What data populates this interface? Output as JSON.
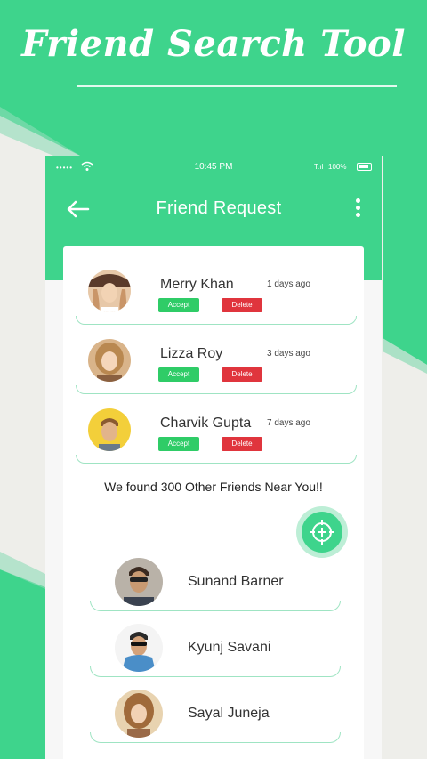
{
  "banner": {
    "title": "Friend Search Tool"
  },
  "colors": {
    "accent": "#3ed48c",
    "accept": "#2fcc67",
    "delete": "#e0353d",
    "background": "#eeeeea"
  },
  "status_bar": {
    "time": "10:45 PM",
    "battery_label": "100%",
    "signal_label": "T.ıl"
  },
  "header": {
    "title": "Friend Request",
    "back_icon": "arrow-left-icon",
    "menu_icon": "more-vertical-icon"
  },
  "requests": [
    {
      "name": "Merry Khan",
      "time": "1 days ago",
      "accept_label": "Accept",
      "delete_label": "Delete"
    },
    {
      "name": "Lizza Roy",
      "time": "3 days ago",
      "accept_label": "Accept",
      "delete_label": "Delete"
    },
    {
      "name": "Charvik Gupta",
      "time": "7 days ago",
      "accept_label": "Accept",
      "delete_label": "Delete"
    }
  ],
  "nearby": {
    "message": "We found 300 Other Friends Near You!!",
    "add_icon": "add-friend-icon",
    "people": [
      {
        "name": "Sunand Barner"
      },
      {
        "name": "Kyunj Savani"
      },
      {
        "name": "Sayal Juneja"
      }
    ]
  }
}
